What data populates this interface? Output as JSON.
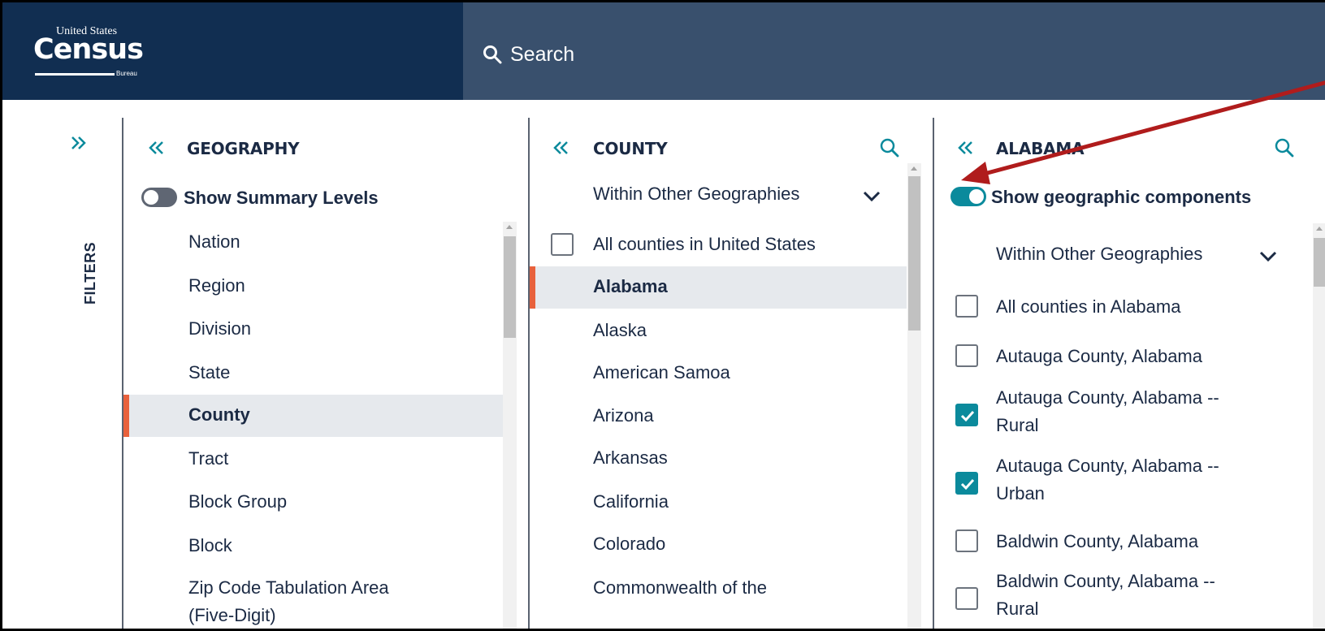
{
  "header": {
    "logo": {
      "line1": "United States",
      "line2": "Census",
      "line3": "Bureau"
    },
    "search_label": "Search"
  },
  "rail": {
    "label": "FILTERS"
  },
  "geography": {
    "title": "GEOGRAPHY",
    "toggle_label": "Show Summary Levels",
    "items": [
      "Nation",
      "Region",
      "Division",
      "State",
      "County",
      "Tract",
      "Block Group",
      "Block",
      "Zip Code Tabulation Area",
      "(Five-Digit)"
    ],
    "selected": "County"
  },
  "county": {
    "title": "COUNTY",
    "dropdown": "Within Other Geographies",
    "all_label": "All counties in United States",
    "items": [
      "Alabama",
      "Alaska",
      "American Samoa",
      "Arizona",
      "Arkansas",
      "California",
      "Colorado",
      "Commonwealth of the"
    ],
    "selected": "Alabama"
  },
  "alabama": {
    "title": "ALABAMA",
    "toggle_label": "Show geographic components",
    "dropdown": "Within Other Geographies",
    "rows": [
      {
        "line1": "All counties in Alabama",
        "line2": "",
        "checked": false
      },
      {
        "line1": "Autauga County, Alabama",
        "line2": "",
        "checked": false
      },
      {
        "line1": "Autauga County, Alabama --",
        "line2": "Rural",
        "checked": true
      },
      {
        "line1": "Autauga County, Alabama --",
        "line2": "Urban",
        "checked": true
      },
      {
        "line1": "Baldwin County, Alabama",
        "line2": "",
        "checked": false
      },
      {
        "line1": "Baldwin County, Alabama --",
        "line2": "Rural",
        "checked": false
      }
    ]
  },
  "colors": {
    "header_dark": "#112e51",
    "header_light": "#39506d",
    "accent_teal": "#0b8a9c",
    "selected_bar": "#e8613c",
    "selected_bg": "#e6e9ed",
    "annotation_arrow": "#b01c1c"
  }
}
